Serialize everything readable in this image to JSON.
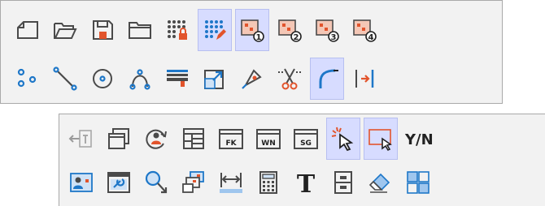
{
  "toolbar_top": {
    "row1": [
      {
        "name": "new-file-icon"
      },
      {
        "name": "open-folder-icon"
      },
      {
        "name": "save-icon"
      },
      {
        "name": "folder-icon"
      },
      {
        "name": "grid-lock-icon"
      },
      {
        "name": "grid-edit-icon",
        "active": true
      },
      {
        "name": "select-one-icon",
        "badge": "1",
        "active": true
      },
      {
        "name": "select-two-icon",
        "badge": "2"
      },
      {
        "name": "select-three-icon",
        "badge": "3"
      },
      {
        "name": "select-four-icon",
        "badge": "4"
      }
    ],
    "row2": [
      {
        "name": "points-icon"
      },
      {
        "name": "line-icon"
      },
      {
        "name": "circle-icon"
      },
      {
        "name": "curve-icon"
      },
      {
        "name": "paint-roller-icon"
      },
      {
        "name": "resize-icon"
      },
      {
        "name": "pen-tool-icon"
      },
      {
        "name": "cut-icon"
      },
      {
        "name": "corner-arc-icon",
        "active": true
      },
      {
        "name": "align-right-icon"
      }
    ]
  },
  "toolbar_bottom": {
    "row1": [
      {
        "name": "back-icon"
      },
      {
        "name": "windows-icon"
      },
      {
        "name": "refresh-user-icon"
      },
      {
        "name": "layout-icon"
      },
      {
        "name": "fk-icon",
        "label": "FK"
      },
      {
        "name": "wn-icon",
        "label": "WN"
      },
      {
        "name": "sg-icon",
        "label": "SG"
      },
      {
        "name": "click-select-icon",
        "active": true
      },
      {
        "name": "rect-select-icon",
        "active": true
      },
      {
        "name": "yes-no-icon",
        "label": "Y/N"
      }
    ],
    "row2": [
      {
        "name": "image-icon"
      },
      {
        "name": "window-settings-icon"
      },
      {
        "name": "zoom-icon"
      },
      {
        "name": "stack-icon"
      },
      {
        "name": "dimension-icon"
      },
      {
        "name": "calculator-icon"
      },
      {
        "name": "text-icon",
        "label": "T"
      },
      {
        "name": "archive-icon"
      },
      {
        "name": "eraser-icon"
      },
      {
        "name": "tiles-icon"
      }
    ]
  }
}
